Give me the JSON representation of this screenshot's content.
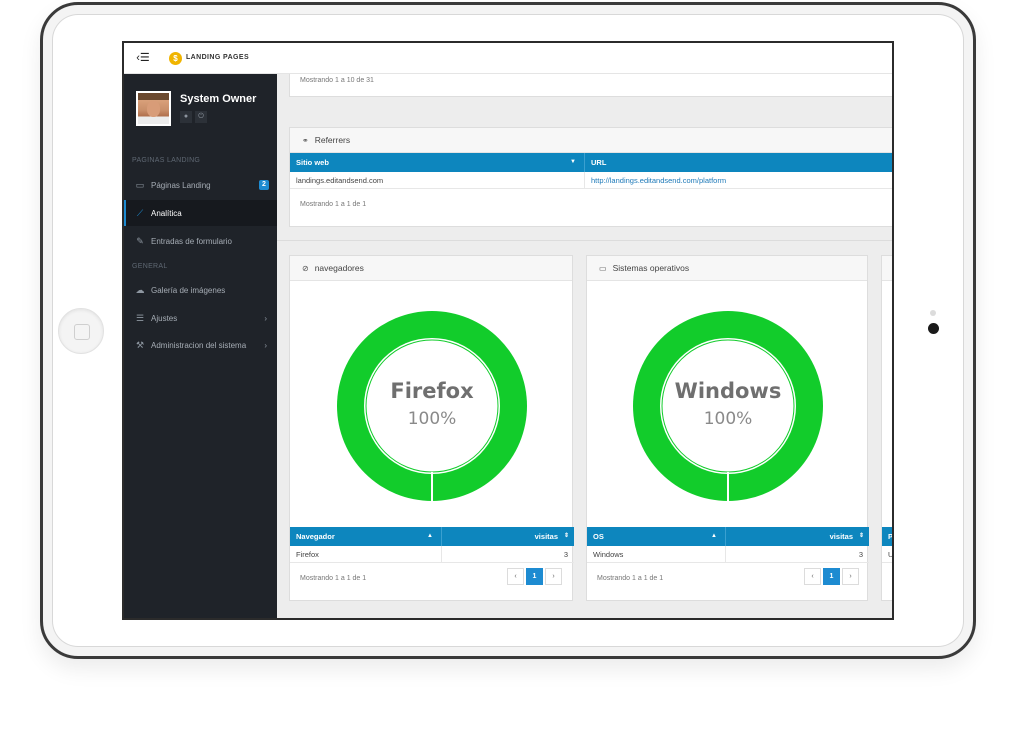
{
  "app": {
    "brand": "LANDING PAGES",
    "menu_toggle": "‹☰"
  },
  "profile": {
    "name": "System Owner"
  },
  "sidebar": {
    "section1": "PAGINAS LANDING",
    "section2": "GENERAL",
    "items": [
      {
        "label": "Páginas Landing",
        "icon": "laptop-icon",
        "badge": "2"
      },
      {
        "label": "Analítica",
        "icon": "line-chart-icon",
        "active": true
      },
      {
        "label": "Entradas de formulario",
        "icon": "edit-icon"
      },
      {
        "label": "Galería de imágenes",
        "icon": "cloud-icon"
      },
      {
        "label": "Ajustes",
        "icon": "sliders-icon",
        "chevron": "›"
      },
      {
        "label": "Administracion del sistema",
        "icon": "wrench-icon",
        "chevron": "›"
      }
    ]
  },
  "top_panel": {
    "showing": "Mostrando 1 a 10 de 31"
  },
  "referrers": {
    "title": "Referrers",
    "columns": [
      "Sitio web",
      "URL"
    ],
    "rows": [
      [
        "landings.editandsend.com",
        "http://landings.editandsend.com/platform"
      ]
    ],
    "showing": "Mostrando 1 a 1 de 1"
  },
  "browsers": {
    "title": "navegadores",
    "donut_label": "Firefox",
    "donut_percent": "100%",
    "columns": [
      "Navegador",
      "visitas"
    ],
    "rows": [
      [
        "Firefox",
        "3"
      ]
    ],
    "showing": "Mostrando 1 a 1 de 1",
    "page": "1"
  },
  "os": {
    "title": "Sistemas operativos",
    "donut_label": "Windows",
    "donut_percent": "100%",
    "columns": [
      "OS",
      "visitas"
    ],
    "rows": [
      [
        "Windows",
        "3"
      ]
    ],
    "showing": "Mostrando 1 a 1 de 1",
    "page": "1"
  },
  "third_panel": {
    "col_initial": "P",
    "row_initial": "U"
  },
  "pager": {
    "prev": "‹",
    "next": "›"
  },
  "colors": {
    "accent": "#0d86be",
    "donut": "#12cc2b",
    "sidebar": "#1f2329"
  },
  "chart_data": [
    {
      "type": "pie",
      "categories": [
        "Firefox"
      ],
      "values": [
        100
      ]
    },
    {
      "type": "pie",
      "categories": [
        "Windows"
      ],
      "values": [
        100
      ]
    }
  ]
}
